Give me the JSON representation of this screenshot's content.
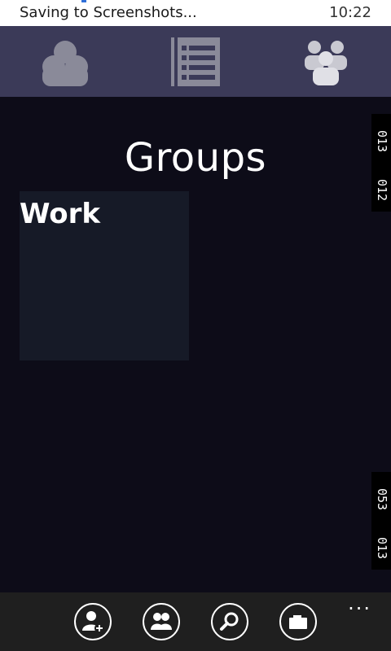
{
  "status_bar": {
    "message": "Saving to Screenshots...",
    "time": "10:22"
  },
  "tabs": [
    {
      "name": "cloud-tab",
      "icon": "cloud-icon"
    },
    {
      "name": "list-tab",
      "icon": "list-icon"
    },
    {
      "name": "groups-tab",
      "icon": "groups-icon"
    }
  ],
  "page": {
    "title": "Groups"
  },
  "groups": [
    {
      "label": "Work"
    }
  ],
  "edge_labels": {
    "top_a": "013",
    "top_b": "012",
    "bottom_a": "053",
    "bottom_b": "013"
  },
  "app_bar": {
    "buttons": [
      {
        "icon": "add-contact-icon"
      },
      {
        "icon": "contacts-icon"
      },
      {
        "icon": "search-icon"
      },
      {
        "icon": "folder-icon"
      }
    ],
    "more": "..."
  },
  "colors": {
    "background": "#0d0c18",
    "tabbar": "#3b3a58",
    "tile": "#161a27",
    "appbar": "#1f1f1f",
    "icon_gray": "#8a8a99"
  }
}
